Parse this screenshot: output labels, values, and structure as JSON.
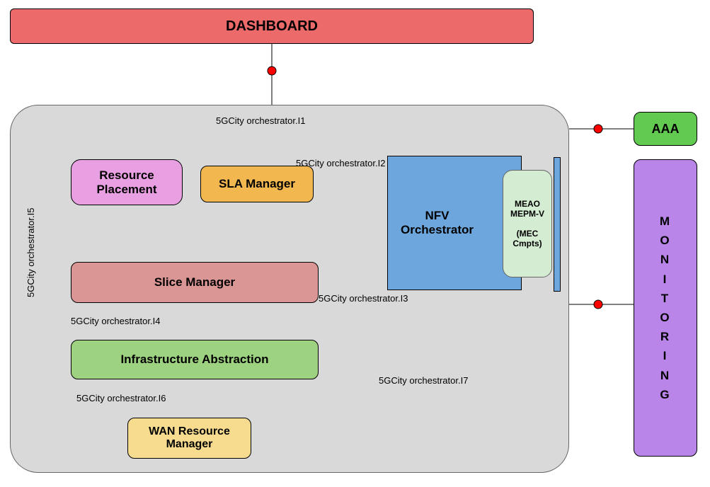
{
  "boxes": {
    "dashboard": "DASHBOARD",
    "resource_placement": "Resource\nPlacement",
    "sla_manager": "SLA Manager",
    "nfv_orchestrator": "NFV\nOrchestrator",
    "mec_label": "MEAO\nMEPM-V\n\n(MEC\nCmpts)",
    "slice_manager": "Slice Manager",
    "infra_abstraction": "Infrastructure Abstraction",
    "wan_manager": "WAN Resource\nManager",
    "aaa": "AAA",
    "monitoring": "MONITORING"
  },
  "interfaces": {
    "i1": "5GCity orchestrator.I1",
    "i2": "5GCity orchestrator.I2",
    "i3": "5GCity orchestrator.I3",
    "i4": "5GCity orchestrator.I4",
    "i5": "5GCity orchestrator.I5",
    "i6": "5GCity orchestrator.I6",
    "i7": "5GCity orchestrator.I7"
  }
}
